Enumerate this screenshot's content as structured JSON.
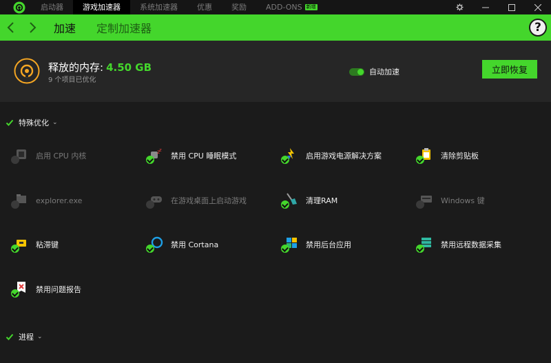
{
  "titlebar": {
    "tabs": [
      {
        "label": "启动器"
      },
      {
        "label": "游戏加速器"
      },
      {
        "label": "系统加速器"
      },
      {
        "label": "优惠"
      },
      {
        "label": "奖励"
      },
      {
        "label": "ADD-ONS",
        "badge": "新增"
      }
    ],
    "active_tab": "游戏加速器"
  },
  "nav": {
    "tabs": [
      {
        "label": "加速"
      },
      {
        "label": "定制加速器"
      }
    ],
    "help_label": "?"
  },
  "summary": {
    "mem_label": "释放的内存:",
    "mem_value": "4.50 GB",
    "items_optimized": "9 个项目已优化",
    "autoboost_label": "自动加速",
    "autoboost_on": true,
    "restore_label": "立即恢复"
  },
  "sections": [
    {
      "label": "特殊优化",
      "items": [
        {
          "label": "启用 CPU 内核",
          "enabled": false,
          "icon": "cpu-core-icon"
        },
        {
          "label": "禁用 CPU 睡眠模式",
          "enabled": true,
          "icon": "cpu-sleep-icon"
        },
        {
          "label": "启用游戏电源解决方案",
          "enabled": true,
          "icon": "power-plan-icon"
        },
        {
          "label": "清除剪贴板",
          "enabled": true,
          "icon": "clipboard-icon"
        },
        {
          "label": "explorer.exe",
          "enabled": false,
          "icon": "explorer-icon"
        },
        {
          "label": "在游戏桌面上启动游戏",
          "enabled": false,
          "icon": "gamepad-icon"
        },
        {
          "label": "清理RAM",
          "enabled": true,
          "icon": "broom-icon"
        },
        {
          "label": "Windows 键",
          "enabled": false,
          "icon": "keyboard-icon"
        },
        {
          "label": "粘滞键",
          "enabled": true,
          "icon": "sticky-keys-icon"
        },
        {
          "label": "禁用 Cortana",
          "enabled": true,
          "icon": "cortana-icon"
        },
        {
          "label": "禁用后台应用",
          "enabled": true,
          "icon": "background-apps-icon"
        },
        {
          "label": "禁用远程数据采集",
          "enabled": true,
          "icon": "telemetry-icon"
        },
        {
          "label": "禁用问题报告",
          "enabled": true,
          "icon": "error-report-icon"
        }
      ]
    },
    {
      "label": "进程",
      "items": []
    }
  ],
  "colors": {
    "accent": "#44d62c",
    "background": "#1b1b1b",
    "panel": "#262626"
  }
}
